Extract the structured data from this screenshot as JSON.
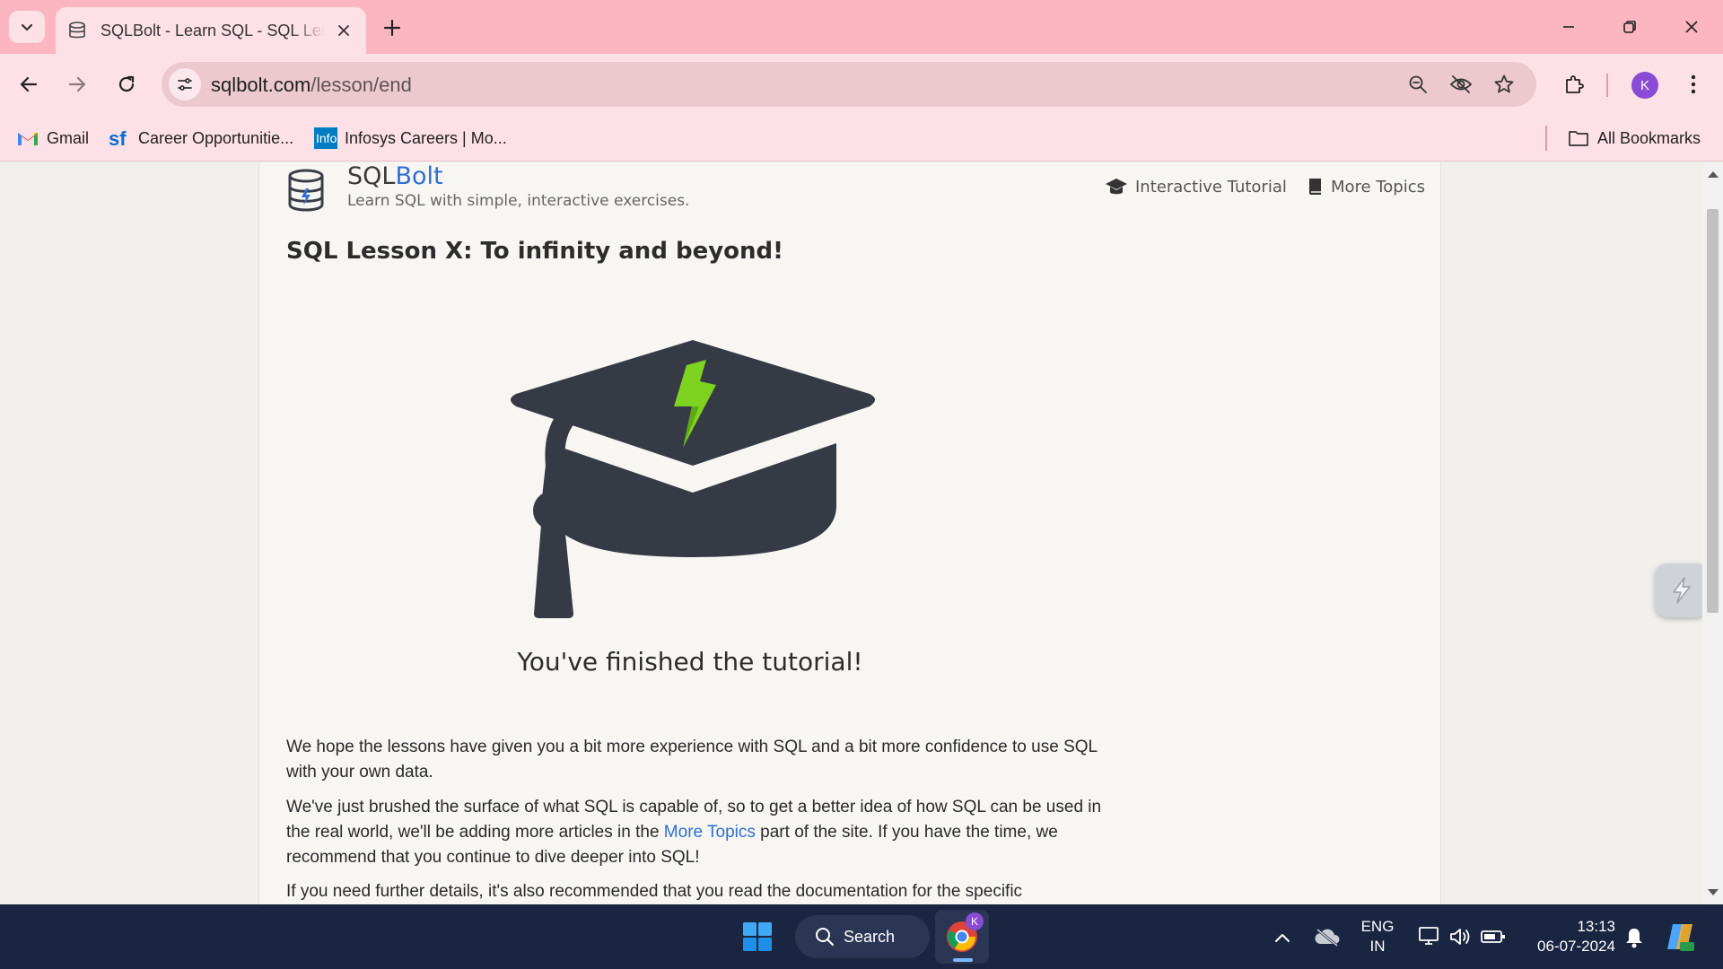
{
  "browser": {
    "tab_title": "SQLBolt - Learn SQL - SQL Lesson X: To infinity and beyond!",
    "url_host": "sqlbolt.com",
    "url_path": "/lesson/end",
    "profile_initial": "K",
    "bookmarks": [
      {
        "label": "Gmail",
        "icon": "gmail-icon"
      },
      {
        "label": "Career Opportunitie...",
        "icon": "successfactors-icon"
      },
      {
        "label": "Infosys Careers | Mo...",
        "icon": "infosys-icon"
      }
    ],
    "all_bookmarks_label": "All Bookmarks",
    "colors": {
      "tabbar": "#fbb6c2",
      "toolbar": "#fde1e6",
      "avatar": "#8a4bd6"
    }
  },
  "page": {
    "brand_part1": "SQL",
    "brand_part2": "Bolt",
    "tagline": "Learn SQL with simple, interactive exercises.",
    "nav": {
      "tutorial": "Interactive Tutorial",
      "more_topics": "More Topics"
    },
    "lesson_title": "SQL Lesson X: To infinity and beyond!",
    "finished_caption": "You've finished the tutorial!",
    "para1": "We hope the lessons have given you a bit more experience with SQL and a bit more confidence to use SQL with your own data.",
    "para2_before": "We've just brushed the surface of what SQL is capable of, so to get a better idea of how SQL can be used in the real world, we'll be adding more articles in the ",
    "para2_link": "More Topics",
    "para2_after": " part of the site. If you have the time, we recommend that you continue to dive deeper into SQL!",
    "para3": "If you need further details, it's also recommended that you read the documentation for the specific",
    "colors": {
      "brand_accent": "#2f6fd2",
      "cap": "#363a44",
      "bolt": "#7ed321"
    }
  },
  "taskbar": {
    "search_label": "Search",
    "language_line1": "ENG",
    "language_line2": "IN",
    "time": "13:13",
    "date": "06-07-2024",
    "chrome_badge": "K"
  }
}
